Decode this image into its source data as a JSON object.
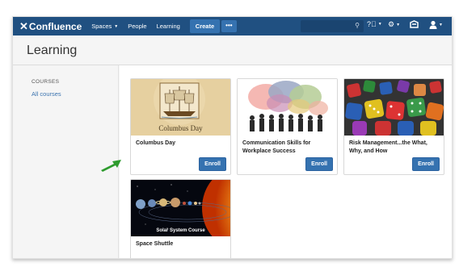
{
  "topnav": {
    "logo_text": "Confluence",
    "items": [
      {
        "label": "Spaces",
        "has_caret": true
      },
      {
        "label": "People"
      },
      {
        "label": "Learning"
      }
    ],
    "create_label": "Create",
    "more_label": "•••"
  },
  "header": {
    "title": "Learning"
  },
  "sidebar": {
    "heading": "COURSES",
    "link": "All courses"
  },
  "courses": [
    {
      "title": "Columbus Day",
      "thumb_caption": "Columbus Day",
      "button": "Enroll"
    },
    {
      "title": "Communication Skills for Workplace Success",
      "button": "Enroll"
    },
    {
      "title": "Risk Management...the What, Why, and How",
      "button": "Enroll"
    },
    {
      "title": "Space Shuttle",
      "thumb_caption": "Solar System Course"
    }
  ],
  "colors": {
    "nav_bg": "#205081",
    "button": "#3572b0",
    "link": "#3b73af",
    "arrow": "#2e9b2e"
  }
}
